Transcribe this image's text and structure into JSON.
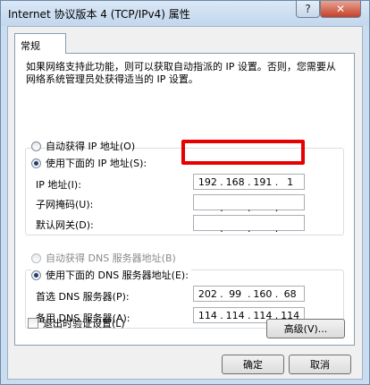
{
  "window": {
    "title": "Internet 协议版本 4 (TCP/IPv4) 属性",
    "help_label": "?",
    "close_label": "✕"
  },
  "tabs": [
    {
      "label": "常规",
      "selected": true
    }
  ],
  "description": "如果网络支持此功能，则可以获取自动指派的 IP 设置。否则，您需要从网络系统管理员处获得适当的 IP 设置。",
  "ip": {
    "auto_label": "自动获得 IP 地址(O)",
    "manual_label": "使用下面的 IP 地址(S):",
    "selected": "manual",
    "address_label": "IP 地址(I):",
    "address": [
      "192",
      "168",
      "191",
      "1"
    ],
    "mask_label": "子网掩码(U):",
    "mask": [
      "",
      "",
      "",
      ""
    ],
    "gateway_label": "默认网关(D):",
    "gateway": [
      "",
      "",
      "",
      ""
    ]
  },
  "dns": {
    "auto_label": "自动获得 DNS 服务器地址(B)",
    "manual_label": "使用下面的 DNS 服务器地址(E):",
    "selected": "manual",
    "preferred_label": "首选 DNS 服务器(P):",
    "preferred": [
      "202",
      "99",
      "160",
      "68"
    ],
    "alternate_label": "备用 DNS 服务器(A):",
    "alternate": [
      "114",
      "114",
      "114",
      "114"
    ]
  },
  "validate_label": "退出时验证设置(L)",
  "advanced_label": "高级(V)...",
  "ok_label": "确定",
  "cancel_label": "取消",
  "highlight_color": "#e60000"
}
